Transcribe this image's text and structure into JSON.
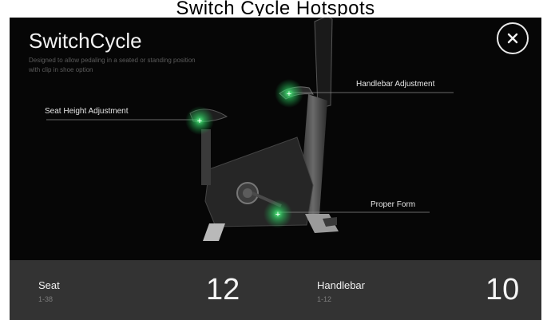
{
  "header": {
    "title": "SwitchCycle",
    "subtitle": "Designed to allow pedaling in a seated or standing position with clip in shoe option",
    "partial_caption": "Switch Cycle Hotspots"
  },
  "hotspots": [
    {
      "label": "Seat Height Adjustment"
    },
    {
      "label": "Handlebar Adjustment"
    },
    {
      "label": "Proper Form"
    }
  ],
  "close": {
    "icon": "close-icon"
  },
  "stats": {
    "seat": {
      "label": "Seat",
      "range": "1-38",
      "value": "12"
    },
    "handlebar": {
      "label": "Handlebar",
      "range": "1-12",
      "value": "10"
    }
  },
  "colors": {
    "background": "#060606",
    "bottom_bar": "#333333",
    "hotspot": "#33e06b"
  }
}
